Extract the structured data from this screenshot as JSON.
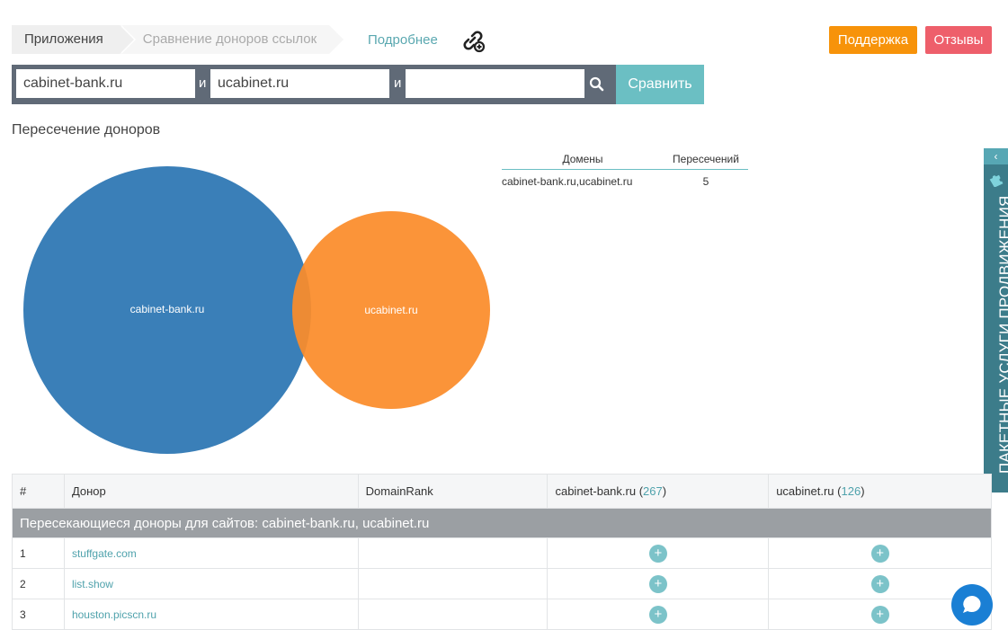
{
  "breadcrumb": {
    "items": [
      "Приложения",
      "Сравнение доноров ссылок"
    ],
    "more_link": "Подробнее",
    "link_icon": "link-add-icon"
  },
  "header_buttons": {
    "support": "Поддержка",
    "reviews": "Отзывы",
    "support_color": "#f7930a",
    "reviews_color": "#ee5f6b"
  },
  "search": {
    "domain1": "cabinet-bank.ru",
    "domain2": "ucabinet.ru",
    "domain3": "",
    "and_label": "и",
    "icon": "search-icon",
    "compare_button": "Сравнить"
  },
  "intersection": {
    "title": "Пересечение доноров",
    "venn": {
      "circles": [
        {
          "label": "cabinet-bank.ru",
          "color": "#3a7fb8"
        },
        {
          "label": "ucabinet.ru",
          "color": "#fb8c2a"
        }
      ]
    },
    "table": {
      "headers": [
        "Домены",
        "Пересечений"
      ],
      "rows": [
        {
          "domains": "cabinet-bank.ru,ucabinet.ru",
          "count": "5"
        }
      ]
    }
  },
  "side_tab": {
    "text": "ПАКЕТНЫЕ УСЛУГИ ПРОДВИЖЕНИЯ",
    "arrow": "‹",
    "icon": "puzzle-icon"
  },
  "donors_table": {
    "headers": {
      "num": "#",
      "donor": "Донор",
      "rank": "DomainRank",
      "site1": "cabinet-bank.ru",
      "site1_count": "267",
      "site2": "ucabinet.ru",
      "site2_count": "126"
    },
    "group_title": "Пересекающиеся доноры для сайтов: cabinet-bank.ru, ucabinet.ru",
    "rows": [
      {
        "num": "1",
        "donor": "stuffgate.com",
        "rank": ""
      },
      {
        "num": "2",
        "donor": "list.show",
        "rank": ""
      },
      {
        "num": "3",
        "donor": "houston.picscn.ru",
        "rank": ""
      }
    ],
    "plus_symbol": "+"
  },
  "chat": {
    "icon": "chat-icon"
  }
}
